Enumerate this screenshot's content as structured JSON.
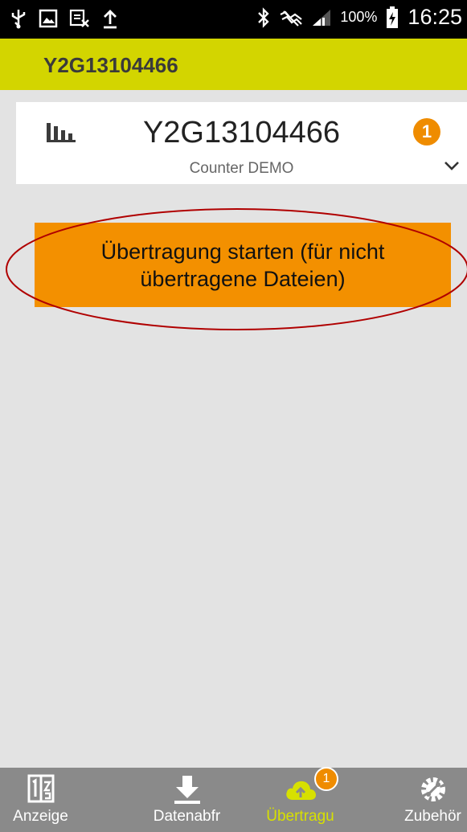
{
  "status_bar": {
    "battery": "100%",
    "time": "16:25",
    "icons": [
      "usb-icon",
      "image-icon",
      "blocked-icon",
      "upload-icon",
      "bluetooth-icon",
      "mute-icon",
      "signal-icon",
      "battery-icon"
    ]
  },
  "app_bar": {
    "title": "Y2G13104466"
  },
  "device_card": {
    "title": "Y2G13104466",
    "subtitle": "Counter DEMO",
    "badge": "1",
    "icons": [
      "chart-icon",
      "chevron-down-icon"
    ]
  },
  "transfer_button": {
    "label": "Übertragung starten (für nicht übertragene Dateien)"
  },
  "bottom_nav": {
    "items": [
      {
        "label": "Anzeige",
        "icon": "counter-display-icon"
      },
      {
        "label": "Datenabfr",
        "icon": "download-icon"
      },
      {
        "label": "Übertragu",
        "icon": "cloud-upload-icon",
        "badge": "1",
        "active": true
      },
      {
        "label": "Zubehör",
        "icon": "gear-wrench-icon"
      }
    ]
  },
  "colors": {
    "app_bar": "#d3d500",
    "accent_orange": "#f39000",
    "badge": "#ef8c00",
    "nav_bg": "#8a8a8a",
    "nav_active": "#d7e000",
    "annotation_ellipse": "#b00000"
  }
}
